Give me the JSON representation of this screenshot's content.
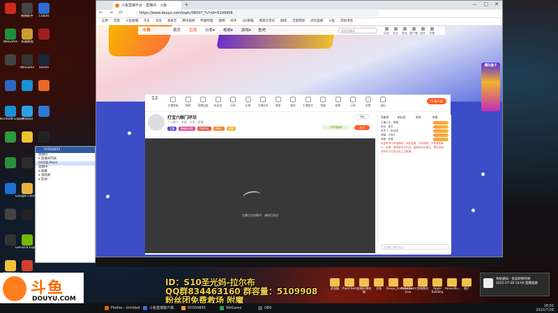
{
  "desktop": {
    "icons": [
      {
        "label": "",
        "color": "#cc2b1d"
      },
      {
        "label": "视频助手",
        "color": "#444444"
      },
      {
        "label": "Cobalt",
        "color": "#2d6bd6"
      },
      {
        "label": "WeGame",
        "color": "#1f8f3a"
      },
      {
        "label": "英雄联盟",
        "color": "#c99b30"
      },
      {
        "label": "",
        "color": "#a01f1f"
      },
      {
        "label": "",
        "color": "#444444"
      },
      {
        "label": "WeGame",
        "color": "#333333"
      },
      {
        "label": "Steam",
        "color": "#1b2838"
      },
      {
        "label": "",
        "color": "#2b66c0"
      },
      {
        "label": "",
        "color": "#1b8fd6"
      },
      {
        "label": "",
        "color": "#e76b25"
      },
      {
        "label": "Microsoft Edge",
        "color": "#1b8fd6"
      },
      {
        "label": "腾讯QQ",
        "color": "#2aa2e8"
      },
      {
        "label": "",
        "color": "#2e7ad6"
      },
      {
        "label": "",
        "color": "#2c9b3f"
      },
      {
        "label": "",
        "color": "#efc22f"
      },
      {
        "label": "",
        "color": "#222222"
      },
      {
        "label": "",
        "color": "#2a8f3b"
      },
      {
        "label": "",
        "color": "#2b2b2b"
      },
      {
        "label": "",
        "color": "#b5382a"
      },
      {
        "label": "",
        "color": "#1f6fd0"
      },
      {
        "label": "Google Chrome",
        "color": "#e9b23a"
      },
      {
        "label": "",
        "color": "#333333"
      },
      {
        "label": "",
        "color": "#444444"
      },
      {
        "label": "",
        "color": "#222222"
      },
      {
        "label": "",
        "color": "#c43a2a"
      },
      {
        "label": "",
        "color": "#333333"
      },
      {
        "label": "GeForce Experience",
        "color": "#76b900"
      },
      {
        "label": "",
        "color": "#222222"
      },
      {
        "label": "PotPlayer",
        "color": "#f0c23a"
      },
      {
        "label": "",
        "color": "#d04030"
      }
    ]
  },
  "browser": {
    "tab_title": "斗鱼直播平台 - 直播间 - 斗鱼",
    "new_tab": "+",
    "window_buttons": [
      "—",
      "□",
      "✕"
    ],
    "nav": [
      "←",
      "→",
      "⟳"
    ],
    "url": "https://www.douyu.com/topic/S6007_%?rid=5109908",
    "bookmarks": [
      "应用",
      "百度",
      "斗鱼直播",
      "京东",
      "淘宝",
      "爱奇艺",
      "腾讯视频",
      "哔哩哔哩",
      "微博",
      "知乎",
      "QQ邮箱",
      "网易云音乐",
      "翻译",
      "百度网盘",
      "虎牙直播",
      "斗鱼",
      "其他书签"
    ]
  },
  "site_nav": {
    "logo": "斗鱼",
    "items": [
      "首页",
      "直播",
      "分类▾",
      "视频▾",
      "游戏▾",
      "鱼吧"
    ],
    "search_placeholder": "搜索直播间",
    "icons": [
      "历史",
      "关注",
      "鱼丸",
      "客户端",
      "创作",
      "开播"
    ],
    "side_ad": "魔玩盒子"
  },
  "room_toolbar": {
    "count": "12",
    "items": [
      "主播等级",
      "弹幕",
      "直播回放",
      "粉丝团",
      "分享",
      "礼物",
      "主播任务",
      "房管",
      "我的"
    ],
    "items_b": [
      "主播图文",
      "鱼塘",
      "超管",
      "订阅",
      "设置",
      "退出"
    ],
    "pc_button": "PC客户端"
  },
  "room": {
    "title": "打宝六眼门环坊",
    "subtitle": "个人简介 · 举报 · 分享 · 直播",
    "tags": [
      {
        "text": "主播",
        "color": "#6a46d8"
      },
      {
        "text": "超级粉丝团",
        "color": "#d94b8c"
      },
      {
        "text": "热度排名",
        "color": "#e0543e"
      },
      {
        "text": "剑网三",
        "color": "#f0842a"
      },
      {
        "text": "关注",
        "color": "#f5b73f"
      }
    ],
    "report": "举报",
    "share": "分享直播间",
    "follow": "关注",
    "video_message": "主播正在加载中，请稍后再试"
  },
  "chat": {
    "tabs": [
      "贡献榜",
      "粉丝团",
      "贵宾",
      "房管"
    ],
    "rows": [
      "主播公告 · 弹幕",
      "粉丝 · 鱼丸",
      "贵宾 1 · 粉丝团",
      "弹幕 · 小鱼干",
      "超管 · 房管"
    ],
    "message": "欢迎来到斗鱼直播间，绿色直播，文明观看。严禁宣扬暴力、色情、赌博等违法内容，直播间仅供娱乐，理性消费，请勿私下交易以免上当受骗。",
    "input_placeholder": "这里输入聊天内容"
  },
  "mini_window": {
    "title": "SYDS4855",
    "rows": [
      "直播间",
      "▾ 直播间列表",
      "  SOD蓝·Mask",
      "  直播中",
      "▾ 收藏",
      "▾ 游戏库",
      "▾ 其他"
    ]
  },
  "overlay": {
    "line1": "ID：S10圣光妈-拉尔布",
    "line2": "QQ群834463160  群容量：5109908",
    "line3": "粉丝团免费救场 附魔"
  },
  "douyu_logo": {
    "cn": "斗鱼",
    "en": "DOUYU.COM"
  },
  "files": [
    "此电脑",
    "PureCharm...",
    "主播开播攻略",
    "文档",
    "Douyu_PureCharm",
    "PureCharm Live",
    "剪辑素材",
    "Apple Building",
    "Honor/Bu...",
    "图片"
  ],
  "toast": {
    "title": "系统通知 · 会议即将开始",
    "body": "2022-07-28 14:00 直播准备"
  },
  "taskbar": {
    "items": [
      {
        "label": "Firefox - Untitled",
        "color": "#e66000"
      },
      {
        "label": "斗鱼直播客户端",
        "color": "#2b73d6"
      },
      {
        "label": "SYDS4855",
        "color": "#f0a030"
      },
      {
        "label": "WeGame",
        "color": "#30a050"
      },
      {
        "label": "OBS",
        "color": "#555555"
      }
    ],
    "time": "18:02",
    "date": "2022/7/28"
  }
}
